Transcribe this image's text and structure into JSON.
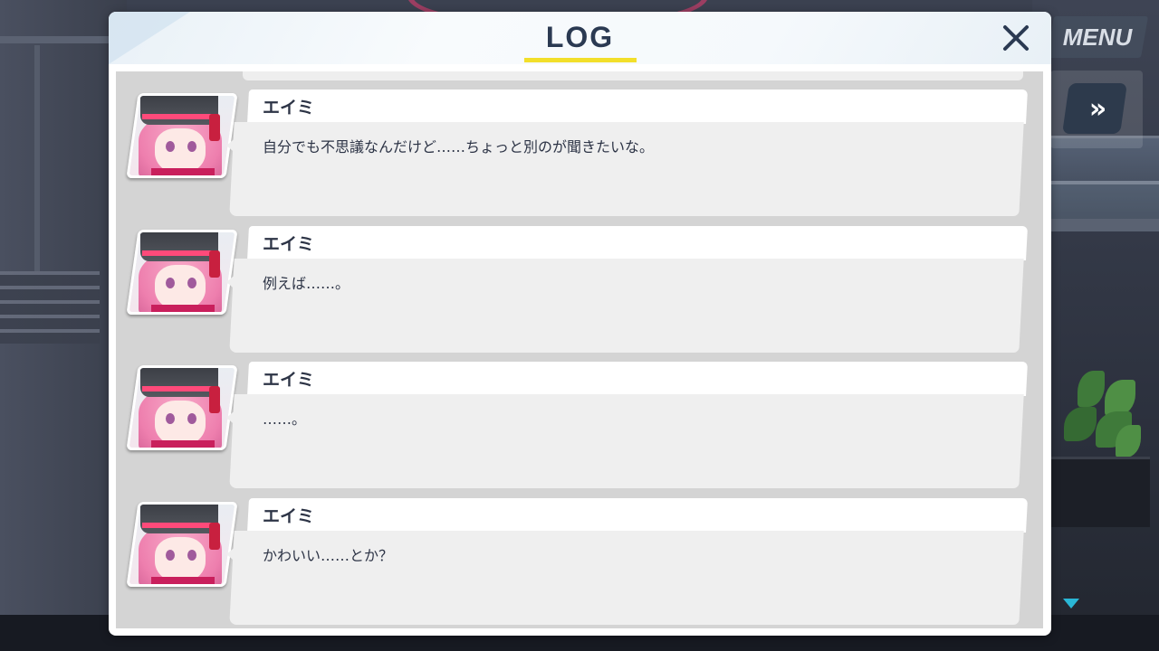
{
  "log": {
    "title": "LOG",
    "entries": [
      {
        "speaker": "エイミ",
        "text": "自分でも不思議なんだけど……ちょっと別のが聞きたいな。"
      },
      {
        "speaker": "エイミ",
        "text": "例えば……。"
      },
      {
        "speaker": "エイミ",
        "text": "……。"
      },
      {
        "speaker": "エイミ",
        "text": "かわいい……とか？"
      }
    ]
  },
  "hud": {
    "menu_label": "MENU",
    "fast_forward_glyph": "»"
  },
  "icons": {
    "close": "close-icon",
    "fast_forward": "fast-forward-icon",
    "scroll_down": "chevron-down-icon"
  },
  "colors": {
    "title": "#2b3a52",
    "title_underline": "#f2df2a",
    "scroll_indicator": "#2ab7d6",
    "portrait_hair": "#ee7fae"
  }
}
